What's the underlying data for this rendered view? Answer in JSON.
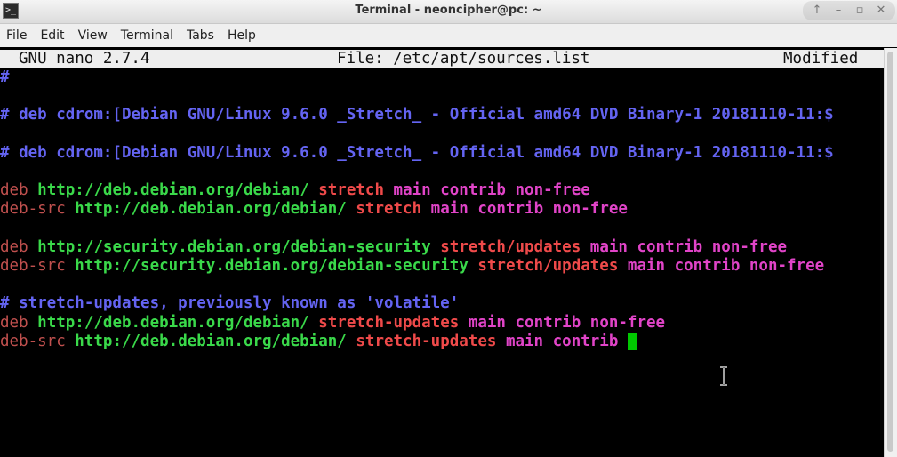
{
  "window": {
    "title": "Terminal - neoncipher@pc: ~",
    "app_icon_glyph": ">_"
  },
  "wm_buttons": [
    {
      "name": "raise-button",
      "glyph": "↑"
    },
    {
      "name": "minimize-button",
      "glyph": "–"
    },
    {
      "name": "maximize-button",
      "glyph": "▫"
    },
    {
      "name": "close-button",
      "glyph": "✕"
    }
  ],
  "menu": [
    "File",
    "Edit",
    "View",
    "Terminal",
    "Tabs",
    "Help"
  ],
  "nano": {
    "version": "GNU nano 2.7.4",
    "file": "File: /etc/apt/sources.list",
    "status": "Modified"
  },
  "lines": [
    {
      "row": 0,
      "segments": [
        {
          "t": "#",
          "c": "comment"
        }
      ]
    },
    {
      "row": 2,
      "segments": [
        {
          "t": "# deb cdrom:[Debian GNU/Linux 9.6.0 _Stretch_ - Official amd64 DVD Binary-1 20181110-11:$",
          "c": "comment"
        }
      ]
    },
    {
      "row": 4,
      "segments": [
        {
          "t": "# deb cdrom:[Debian GNU/Linux 9.6.0 _Stretch_ - Official amd64 DVD Binary-1 20181110-11:$",
          "c": "comment"
        }
      ]
    },
    {
      "row": 6,
      "segments": [
        {
          "t": "deb ",
          "c": "deb"
        },
        {
          "t": "http://deb.debian.org/debian/ ",
          "c": "url"
        },
        {
          "t": "stretch ",
          "c": "dist"
        },
        {
          "t": "main contrib non-free",
          "c": "comp"
        }
      ]
    },
    {
      "row": 7,
      "segments": [
        {
          "t": "deb-src ",
          "c": "deb"
        },
        {
          "t": "http://deb.debian.org/debian/ ",
          "c": "url"
        },
        {
          "t": "stretch ",
          "c": "dist"
        },
        {
          "t": "main contrib non-free",
          "c": "comp"
        }
      ]
    },
    {
      "row": 9,
      "segments": [
        {
          "t": "deb ",
          "c": "deb"
        },
        {
          "t": "http://security.debian.org/debian-security ",
          "c": "url"
        },
        {
          "t": "stretch/updates ",
          "c": "dist"
        },
        {
          "t": "main contrib non-free",
          "c": "comp"
        }
      ]
    },
    {
      "row": 10,
      "segments": [
        {
          "t": "deb-src ",
          "c": "deb"
        },
        {
          "t": "http://security.debian.org/debian-security ",
          "c": "url"
        },
        {
          "t": "stretch/updates ",
          "c": "dist"
        },
        {
          "t": "main contrib non-free",
          "c": "comp"
        }
      ]
    },
    {
      "row": 12,
      "segments": [
        {
          "t": "# stretch-updates, previously known as 'volatile'",
          "c": "comment"
        }
      ]
    },
    {
      "row": 13,
      "segments": [
        {
          "t": "deb ",
          "c": "deb"
        },
        {
          "t": "http://deb.debian.org/debian/ ",
          "c": "url"
        },
        {
          "t": "stretch-updates ",
          "c": "dist"
        },
        {
          "t": "main contrib non-free",
          "c": "comp"
        }
      ]
    },
    {
      "row": 14,
      "segments": [
        {
          "t": "deb-src ",
          "c": "deb"
        },
        {
          "t": "http://deb.debian.org/debian/ ",
          "c": "url"
        },
        {
          "t": "stretch-updates ",
          "c": "dist"
        },
        {
          "t": "main contrib ",
          "c": "comp"
        }
      ],
      "cursor": true
    }
  ],
  "colors": {
    "comment": "#6464f2",
    "deb": "#c0504e",
    "url": "#3ad94a",
    "dist": "#ef4a4a",
    "comp": "#e144c8",
    "cursor": "#00c800"
  }
}
